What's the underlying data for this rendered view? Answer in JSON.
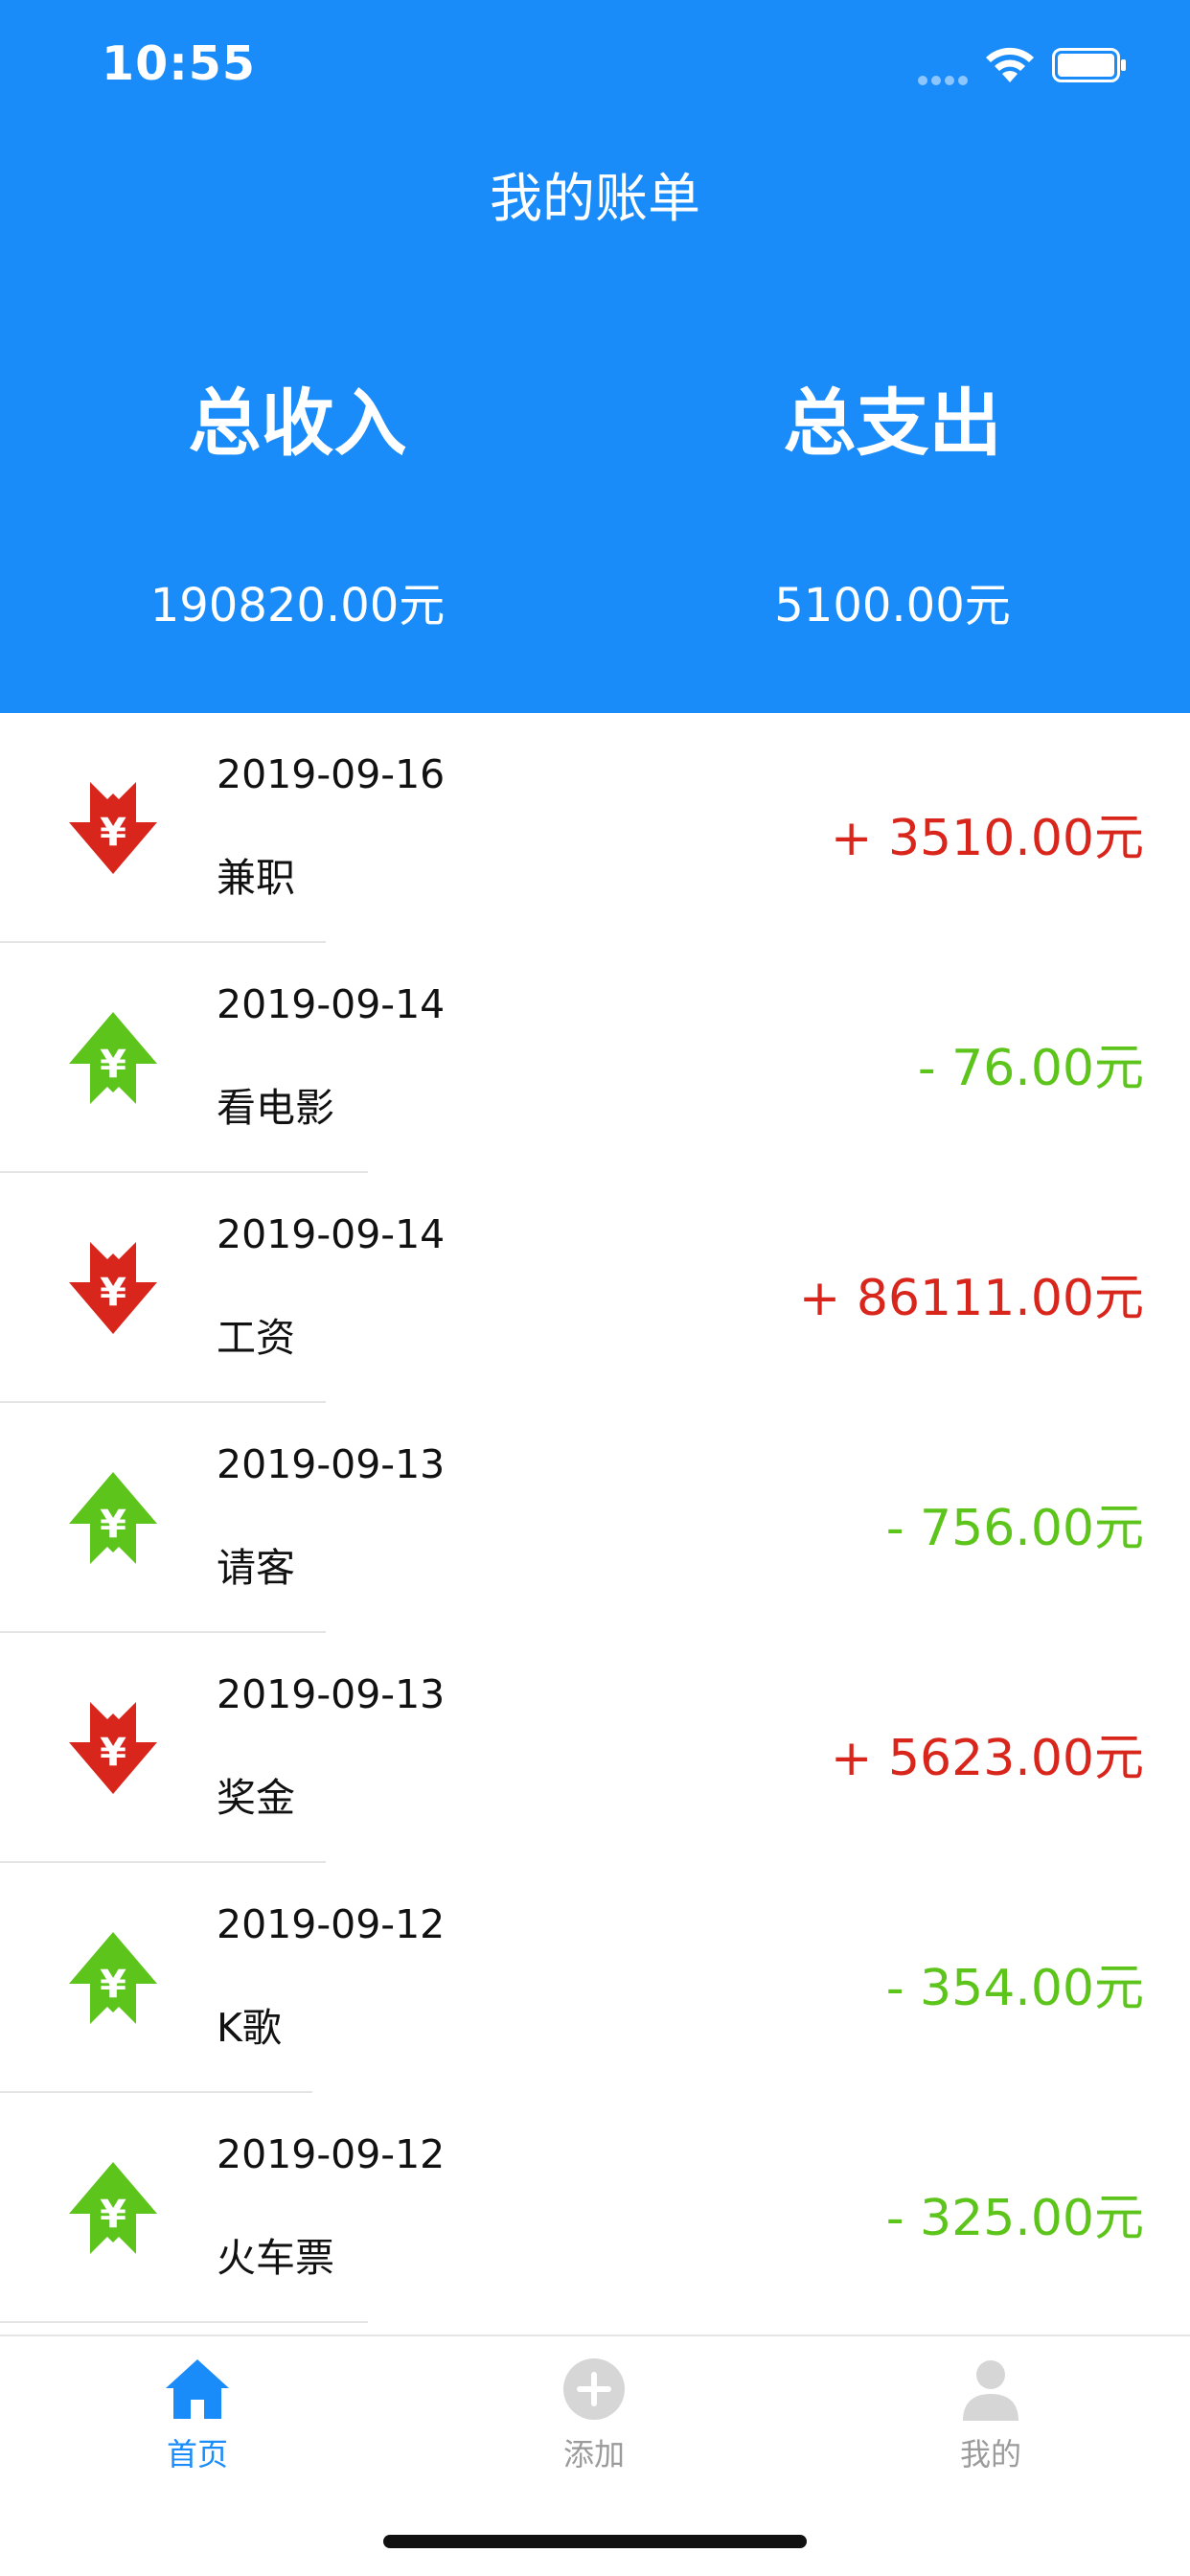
{
  "status_bar": {
    "time": "10:55"
  },
  "header": {
    "title": "我的账单",
    "income_label": "总收入",
    "income_amount": "190820.00元",
    "expense_label": "总支出",
    "expense_amount": "5100.00元"
  },
  "colors": {
    "primary": "#1a8cf9",
    "income": "#d9261c",
    "expense": "#5dc41c"
  },
  "records": [
    {
      "date": "2019-09-16",
      "name": "兼职",
      "amount": "+ 3510.00元",
      "type": "income",
      "icon": "yen-down-arrow-icon"
    },
    {
      "date": "2019-09-14",
      "name": "看电影",
      "amount": "- 76.00元",
      "type": "expense",
      "icon": "yen-up-arrow-icon"
    },
    {
      "date": "2019-09-14",
      "name": "工资",
      "amount": "+ 86111.00元",
      "type": "income",
      "icon": "yen-down-arrow-icon"
    },
    {
      "date": "2019-09-13",
      "name": "请客",
      "amount": "- 756.00元",
      "type": "expense",
      "icon": "yen-up-arrow-icon"
    },
    {
      "date": "2019-09-13",
      "name": "奖金",
      "amount": "+ 5623.00元",
      "type": "income",
      "icon": "yen-down-arrow-icon"
    },
    {
      "date": "2019-09-12",
      "name": "K歌",
      "amount": "- 354.00元",
      "type": "expense",
      "icon": "yen-up-arrow-icon"
    },
    {
      "date": "2019-09-12",
      "name": "火车票",
      "amount": "- 325.00元",
      "type": "expense",
      "icon": "yen-up-arrow-icon"
    }
  ],
  "tabbar": {
    "home_label": "首页",
    "add_label": "添加",
    "mine_label": "我的"
  }
}
